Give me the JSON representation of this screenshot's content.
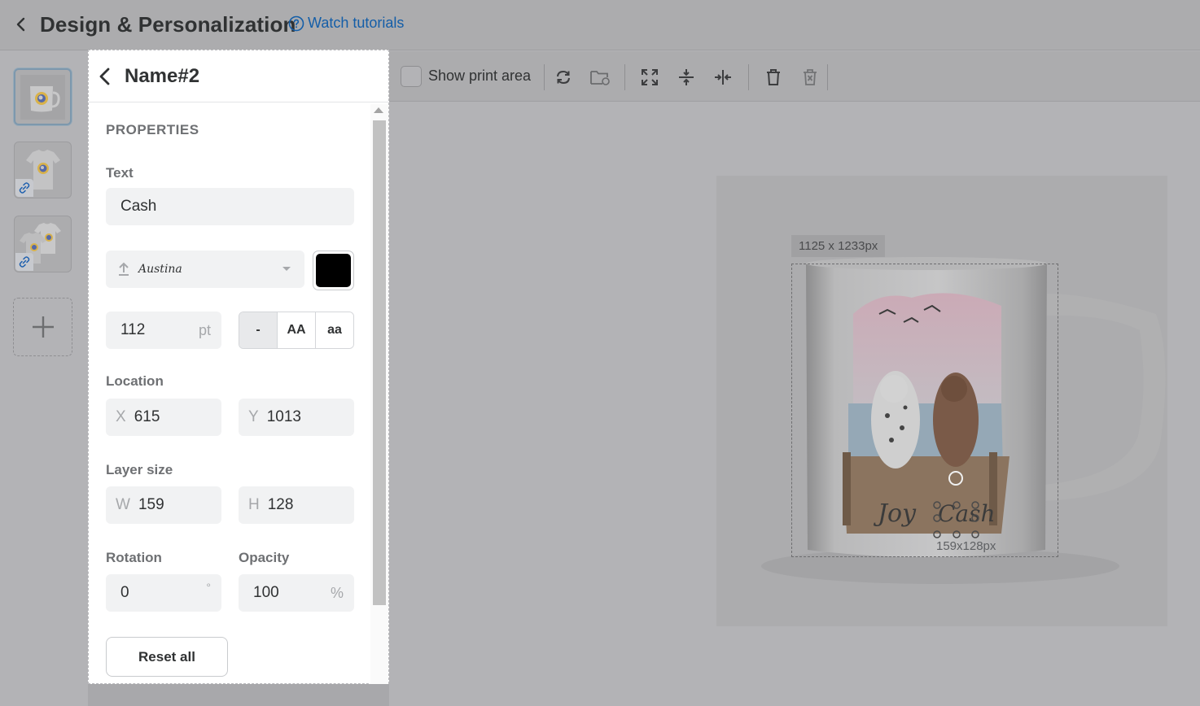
{
  "header": {
    "title": "Design & Personalization",
    "tutorial_label": "Watch tutorials"
  },
  "rail": {
    "products": [
      "Mug",
      "T-shirt",
      "T-shirt pair"
    ],
    "add_label": "+"
  },
  "panel": {
    "layer_name": "Name#2",
    "section": "PROPERTIES",
    "text_label": "Text",
    "text_value": "Cash",
    "font_name": "Austina",
    "color_hex": "#000000",
    "font_size": "112",
    "font_size_unit": "pt",
    "case_options": [
      "-",
      "AA",
      "aa"
    ],
    "case_selected": "-",
    "location_label": "Location",
    "x_prefix": "X",
    "x_value": "615",
    "y_prefix": "Y",
    "y_value": "1013",
    "size_label": "Layer size",
    "w_prefix": "W",
    "w_value": "159",
    "h_prefix": "H",
    "h_value": "128",
    "rotation_label": "Rotation",
    "rotation_value": "0",
    "rotation_unit": "°",
    "opacity_label": "Opacity",
    "opacity_value": "100",
    "opacity_unit": "%",
    "reset_label": "Reset all"
  },
  "toolbar": {
    "print_area_label": "Show print area",
    "print_area_checked": false,
    "icons": [
      "sync-icon",
      "folder-sync-icon",
      "fit-icon",
      "align-vertical-center-icon",
      "align-horizontal-center-icon",
      "delete-icon",
      "delete-all-icon"
    ]
  },
  "canvas": {
    "print_area_size": "1125 x 1233px",
    "layer_size": "159x128px",
    "design_names": [
      "Joy",
      "Cash"
    ]
  }
}
